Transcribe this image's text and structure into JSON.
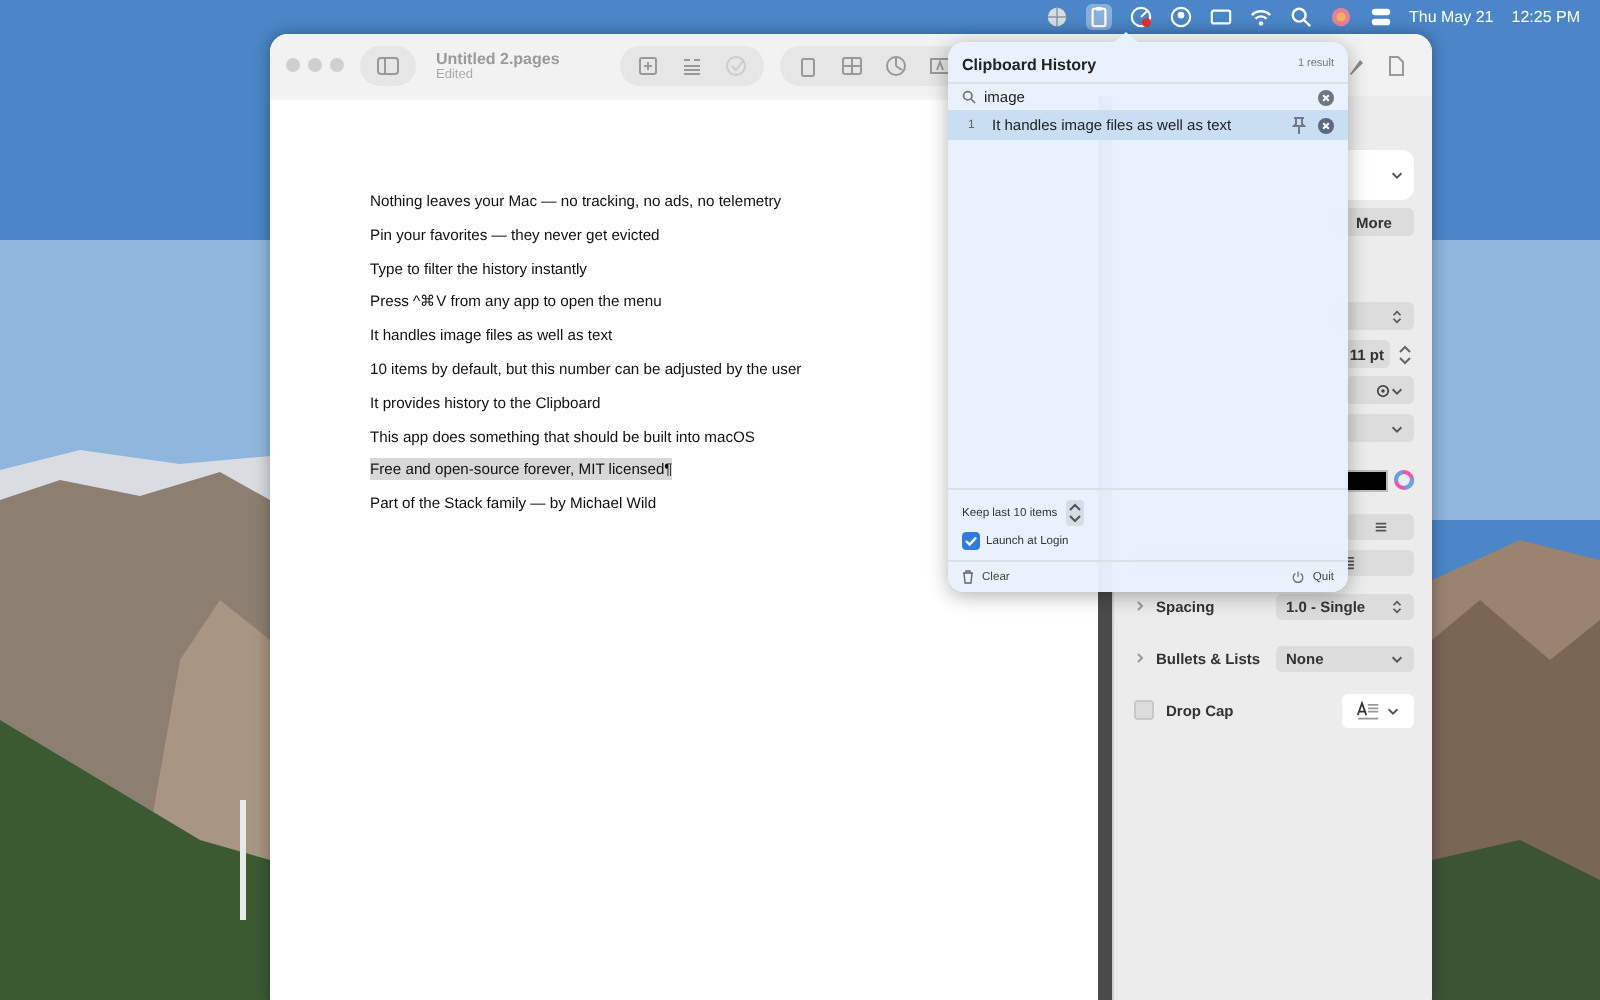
{
  "menu_bar": {
    "date": "Thu May 21",
    "time": "12:25 PM"
  },
  "pages_window": {
    "title": "Untitled 2.pages",
    "subtitle": "Edited",
    "lines": [
      {
        "text": "Nothing leaves your Mac — no tracking, no ads, no telemetry",
        "selected": false
      },
      {
        "text": "Pin your favorites — they never get evicted",
        "selected": false
      },
      {
        "text": "Type to filter the history instantly",
        "selected": false
      },
      {
        "text": "Press ^⌘V from any app to open the menu",
        "selected": false
      },
      {
        "text": "It handles image files as well as text",
        "selected": false
      },
      {
        "text": "10 items by default, but this number can be adjusted by the user",
        "selected": false
      },
      {
        "text": "It provides history to the Clipboard",
        "selected": false
      },
      {
        "text": "This app does something that should be built into macOS",
        "selected": false
      },
      {
        "text": "Free and open-source forever, MIT licensed¶",
        "selected": true
      },
      {
        "text": "Part of the Stack family — by Michael Wild",
        "selected": false
      }
    ]
  },
  "inspector": {
    "more_button": "More",
    "font_size": "11 pt",
    "spacing": {
      "label": "Spacing",
      "value": "1.0 - Single"
    },
    "bullets": {
      "label": "Bullets & Lists",
      "value": "None"
    },
    "drop_cap": {
      "label": "Drop Cap",
      "checked": false
    }
  },
  "clipboard_popup": {
    "title": "Clipboard History",
    "count": "1 result",
    "search": "image",
    "results": [
      {
        "index": "1",
        "text": "It handles image files as well as text",
        "selected": true
      }
    ],
    "keep_label": "Keep last 10 items",
    "launch_at_login": {
      "label": "Launch at Login",
      "checked": true
    },
    "clear": "Clear",
    "quit": "Quit"
  }
}
